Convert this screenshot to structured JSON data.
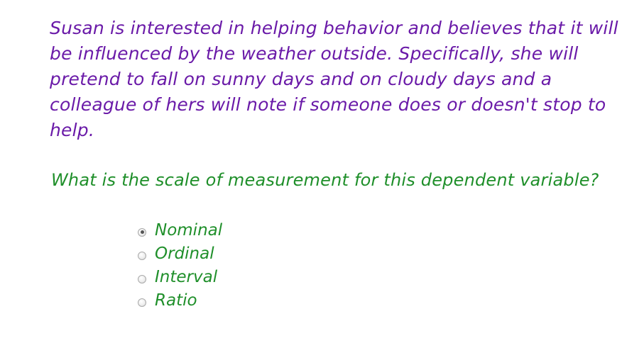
{
  "scenario": {
    "lines": [
      "Susan is interested in helping behavior and believes that it will",
      "be influenced by the weather outside. Specifically, she will",
      "pretend to fall on sunny days and on cloudy days and a",
      "colleague of hers will note if someone does or doesn't stop to",
      "help."
    ]
  },
  "question": {
    "text": "What is the scale of measurement for this dependent variable?"
  },
  "options": [
    {
      "label": "Nominal",
      "selected": true
    },
    {
      "label": "Ordinal",
      "selected": false
    },
    {
      "label": "Interval",
      "selected": false
    },
    {
      "label": "Ratio",
      "selected": false
    }
  ],
  "colors": {
    "scenario_text": "#6a1aa8",
    "question_text": "#1f8f2a",
    "option_text": "#1f8f2a"
  }
}
